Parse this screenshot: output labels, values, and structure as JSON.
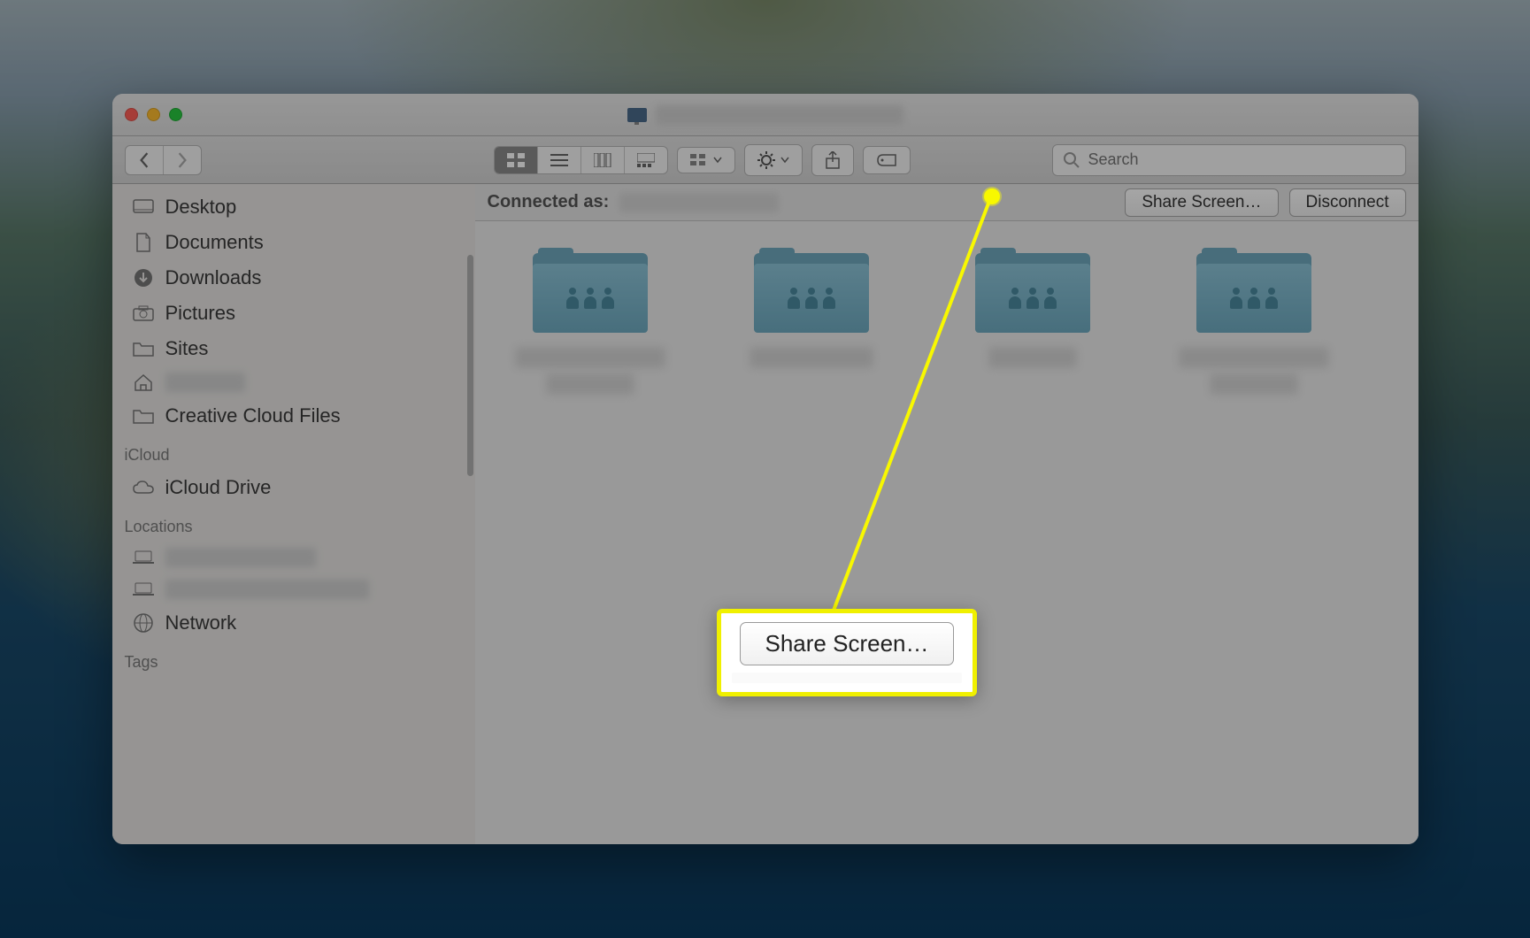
{
  "window_title_redacted": true,
  "toolbar": {
    "back": "‹",
    "forward": "›",
    "gear": "⚙︎",
    "share": "⇪",
    "tag": "⊘"
  },
  "search": {
    "placeholder": "Search"
  },
  "sidebar": {
    "favorites": [
      {
        "label": "Desktop",
        "icon": "desktop"
      },
      {
        "label": "Documents",
        "icon": "document"
      },
      {
        "label": "Downloads",
        "icon": "download"
      },
      {
        "label": "Pictures",
        "icon": "camera"
      },
      {
        "label": "Sites",
        "icon": "folder"
      },
      {
        "label": "",
        "icon": "home",
        "redacted": true
      },
      {
        "label": "Creative Cloud Files",
        "icon": "folder"
      }
    ],
    "sections": {
      "icloud": {
        "heading": "iCloud",
        "items": [
          {
            "label": "iCloud Drive",
            "icon": "cloud"
          }
        ]
      },
      "locations": {
        "heading": "Locations",
        "items": [
          {
            "label": "",
            "icon": "laptop",
            "redacted": true
          },
          {
            "label": "",
            "icon": "laptop",
            "redacted": true
          },
          {
            "label": "Network",
            "icon": "globe"
          }
        ]
      },
      "tags": {
        "heading": "Tags"
      }
    }
  },
  "connection_bar": {
    "label": "Connected as:",
    "user_redacted": true,
    "share_screen": "Share Screen…",
    "disconnect": "Disconnect"
  },
  "files": [
    {
      "redacted": true
    },
    {
      "redacted": true
    },
    {
      "redacted": true
    },
    {
      "redacted": true
    }
  ],
  "callout": {
    "button_label": "Share Screen…"
  }
}
